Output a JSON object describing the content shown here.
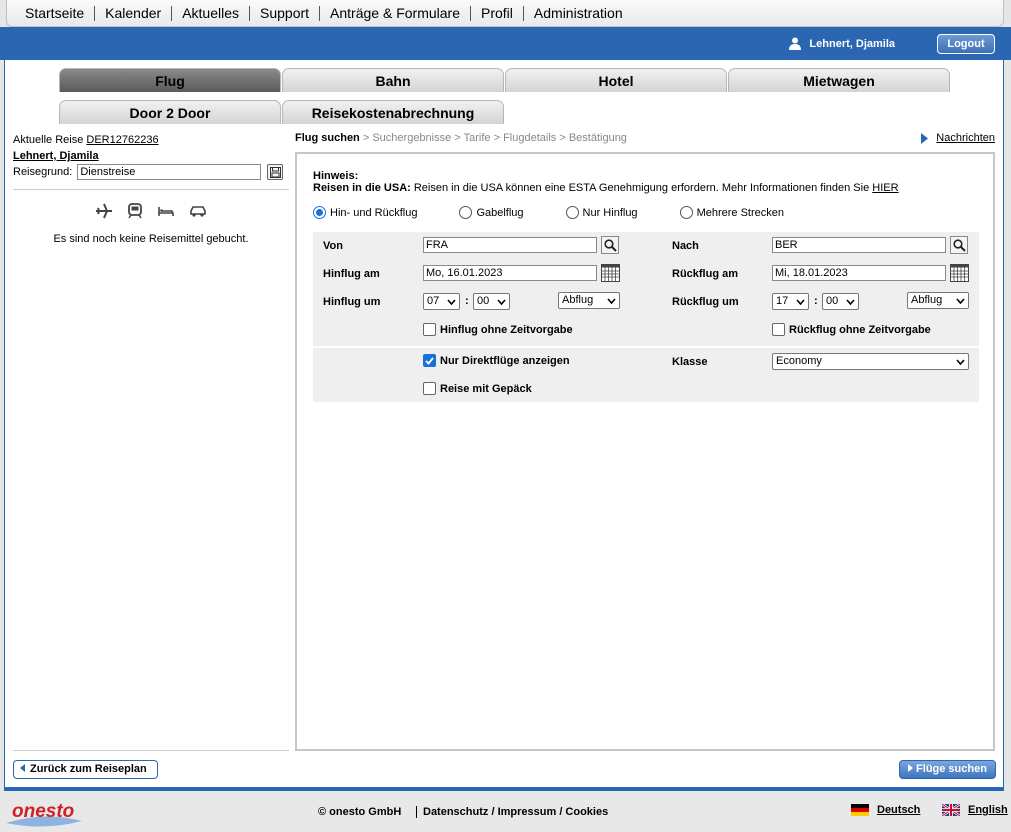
{
  "topnav": [
    "Startseite",
    "Kalender",
    "Aktuelles",
    "Support",
    "Anträge & Formulare",
    "Profil",
    "Administration"
  ],
  "header": {
    "user_name": "Lehnert, Djamila",
    "logout_label": "Logout"
  },
  "tabs": {
    "row1": [
      "Flug",
      "Bahn",
      "Hotel",
      "Mietwagen"
    ],
    "row2": [
      "Door 2 Door",
      "Reisekostenabrechnung"
    ],
    "active": "Flug"
  },
  "sidebar": {
    "current_trip_label": "Aktuelle Reise",
    "current_trip_id": "DER12762236",
    "traveler_name": "Lehnert, Djamila",
    "reason_label": "Reisegrund:",
    "reason_value": "Dienstreise",
    "icons": [
      "plane-icon",
      "train-icon",
      "hotel-bed-icon",
      "car-icon"
    ],
    "no_booking_text": "Es sind noch keine Reisemittel gebucht.",
    "back_button": "Zurück zum Reiseplan"
  },
  "breadcrumb": {
    "current": "Flug suchen",
    "steps": [
      "Suchergebnisse",
      "Tarife",
      "Flugdetails",
      "Bestätigung"
    ],
    "separator": ">"
  },
  "messages_link": "Nachrichten",
  "hint": {
    "title": "Hinweis:",
    "bold_prefix": "Reisen in die USA:",
    "text": " Reisen in die USA können eine ESTA Genehmigung erfordern. Mehr Informationen finden Sie ",
    "link": "HIER"
  },
  "trip_types": [
    {
      "label": "Hin- und Rückflug",
      "selected": true
    },
    {
      "label": "Gabelflug",
      "selected": false
    },
    {
      "label": "Nur Hinflug",
      "selected": false
    },
    {
      "label": "Mehrere Strecken",
      "selected": false
    }
  ],
  "form": {
    "from_label": "Von",
    "from_value": "FRA",
    "to_label": "Nach",
    "to_value": "BER",
    "outbound_date_label": "Hinflug am",
    "outbound_date_value": "Mo, 16.01.2023",
    "return_date_label": "Rückflug am",
    "return_date_value": "Mi, 18.01.2023",
    "outbound_time_label": "Hinflug um",
    "outbound_hour": "07",
    "outbound_minute": "00",
    "outbound_mode": "Abflug",
    "return_time_label": "Rückflug um",
    "return_hour": "17",
    "return_minute": "00",
    "return_mode": "Abflug",
    "time_colon": ":",
    "outbound_no_time_label": "Hinflug ohne Zeitvorgabe",
    "outbound_no_time_checked": false,
    "return_no_time_label": "Rückflug ohne Zeitvorgabe",
    "return_no_time_checked": false,
    "direct_only_label": "Nur Direktflüge anzeigen",
    "direct_only_checked": true,
    "baggage_label": "Reise mit Gepäck",
    "baggage_checked": false,
    "class_label": "Klasse",
    "class_value": "Economy"
  },
  "search_button": "Flüge suchen",
  "footer": {
    "copyright": "© onesto GmbH",
    "legal": "Datenschutz / Impressum / Cookies",
    "lang_de": "Deutsch",
    "lang_en": "English",
    "logo_text": "onesto"
  },
  "colors": {
    "brand_blue": "#2a66b1",
    "accent_blue": "#1a6fd8",
    "field_bg": "#efefef"
  }
}
